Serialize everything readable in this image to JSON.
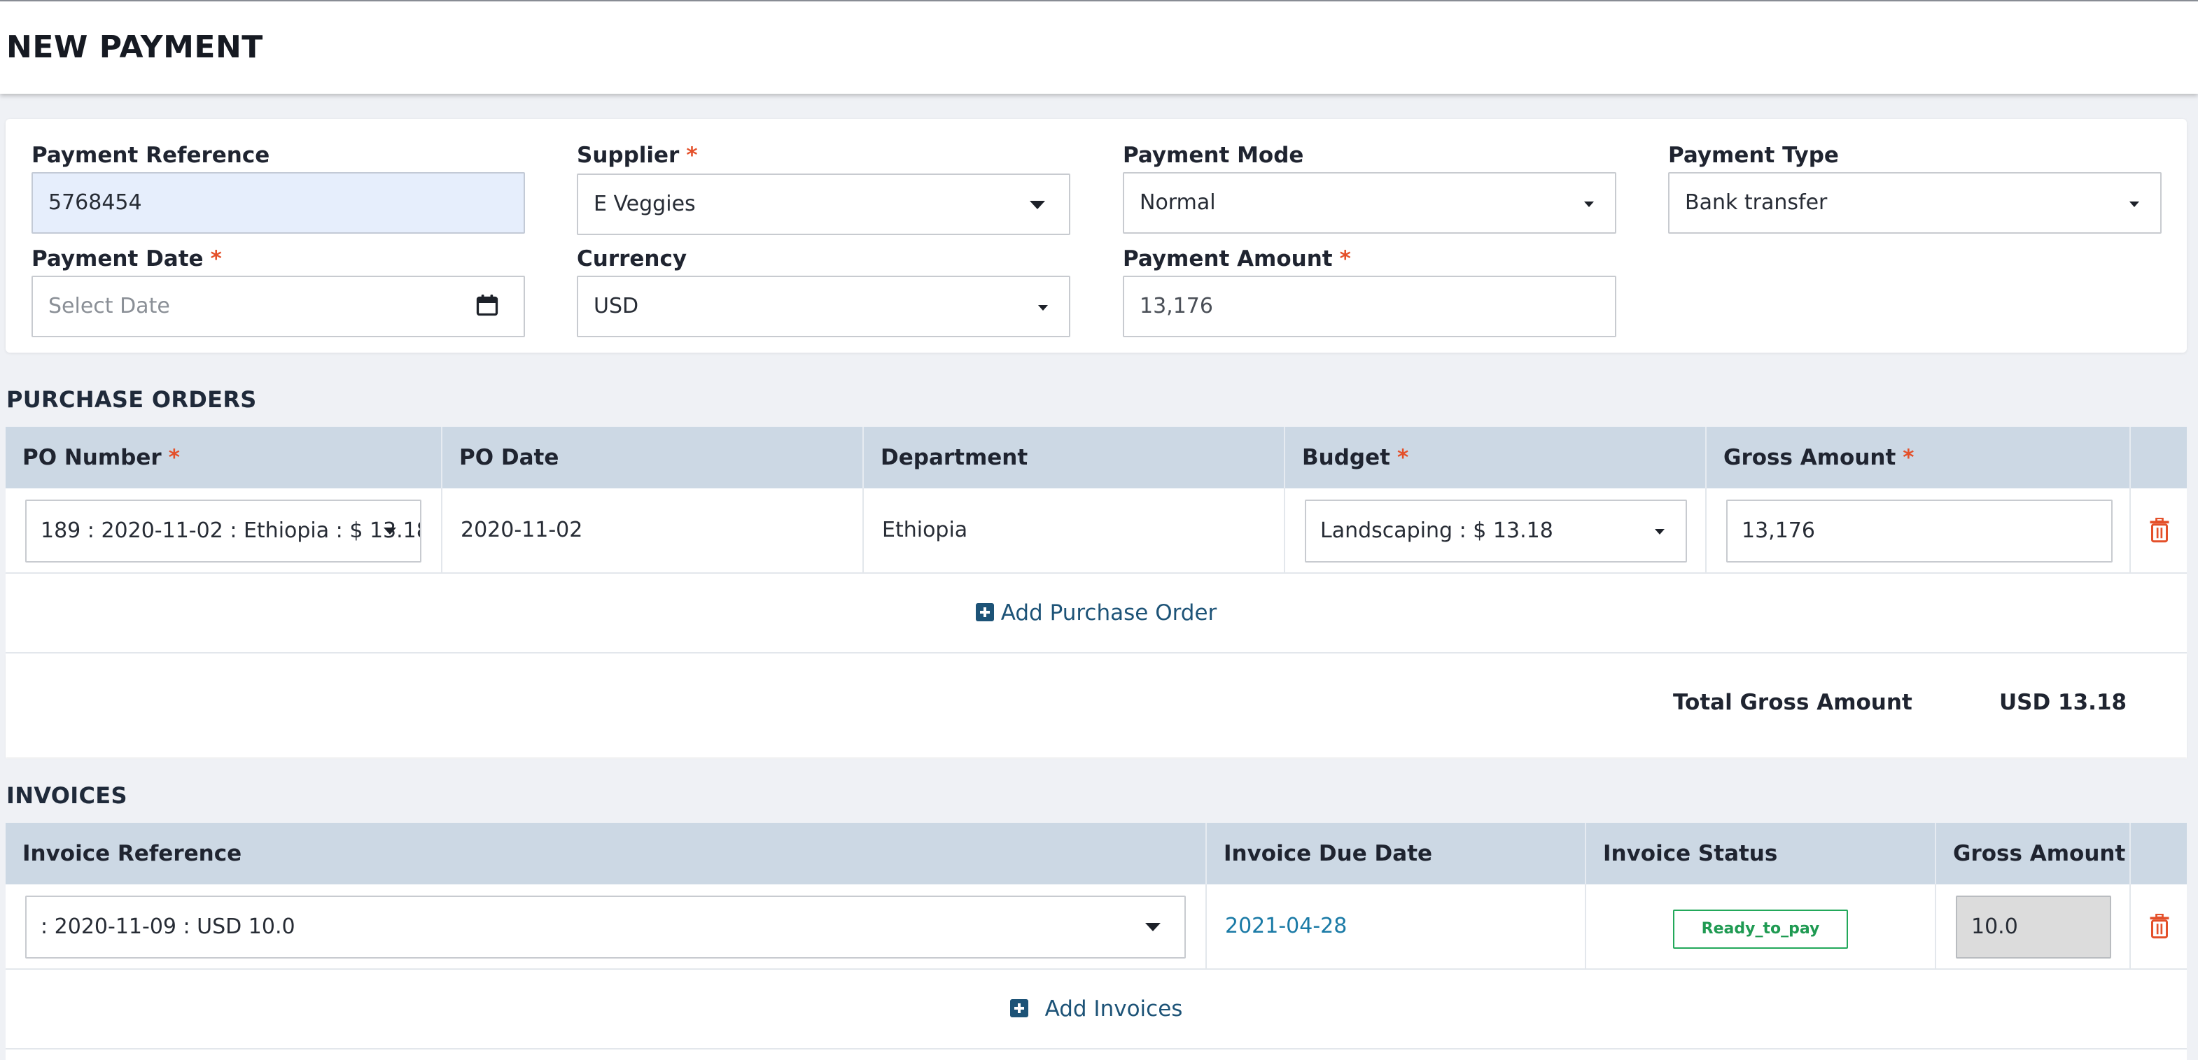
{
  "page": {
    "title": "NEW PAYMENT"
  },
  "form": {
    "payment_reference": {
      "label": "Payment Reference",
      "value": "5768454"
    },
    "supplier": {
      "label": "Supplier",
      "required_mark": "*",
      "value": "E Veggies"
    },
    "payment_mode": {
      "label": "Payment Mode",
      "value": "Normal"
    },
    "payment_type": {
      "label": "Payment Type",
      "value": "Bank transfer"
    },
    "payment_date": {
      "label": "Payment Date",
      "required_mark": "*",
      "placeholder": "Select Date"
    },
    "currency": {
      "label": "Currency",
      "value": "USD"
    },
    "payment_amount": {
      "label": "Payment Amount",
      "required_mark": "*",
      "value": "13,176"
    }
  },
  "purchase_orders": {
    "title": "PURCHASE ORDERS",
    "columns": [
      {
        "label": "PO Number",
        "required_mark": "*"
      },
      {
        "label": "PO Date"
      },
      {
        "label": "Department"
      },
      {
        "label": "Budget",
        "required_mark": "*"
      },
      {
        "label": "Gross Amount",
        "required_mark": "*"
      }
    ],
    "rows": [
      {
        "po_number": "189 : 2020-11-02 : Ethiopia : $ 13.18",
        "po_date": "2020-11-02",
        "department": "Ethiopia",
        "budget": "Landscaping : $ 13.18",
        "gross_amount": "13,176"
      }
    ],
    "add_label": "Add Purchase Order",
    "total_label": "Total Gross Amount",
    "total_value": "USD 13.18"
  },
  "invoices": {
    "title": "INVOICES",
    "columns": [
      {
        "label": "Invoice Reference"
      },
      {
        "label": "Invoice Due Date"
      },
      {
        "label": "Invoice Status"
      },
      {
        "label": "Gross Amount"
      }
    ],
    "rows": [
      {
        "reference": ": 2020-11-09 : USD 10.0",
        "due_date": "2021-04-28",
        "status": "Ready_to_pay",
        "gross_amount": "10.0"
      }
    ],
    "add_label": "Add Invoices"
  },
  "colors": {
    "required": "#e4502a",
    "link": "#1d5377",
    "date_link": "#1a7aa6",
    "status_ready": "#22a85a",
    "trash": "#e4502a",
    "table_header": "#ccd8e4"
  },
  "icons": [
    "calendar-icon",
    "chevron-down-icon",
    "trash-icon",
    "plus-square-icon"
  ]
}
